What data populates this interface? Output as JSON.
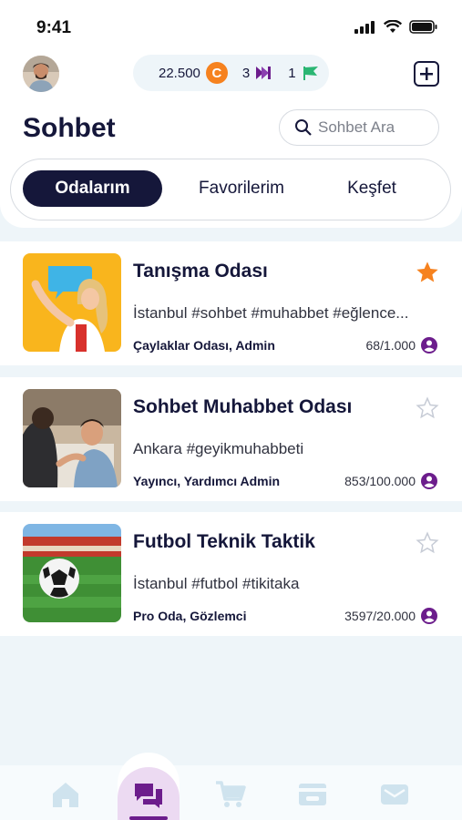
{
  "status_bar": {
    "time": "9:41"
  },
  "header": {
    "coins": "22.500",
    "coin_symbol": "C",
    "tickets": "3",
    "flags": "1"
  },
  "page": {
    "title": "Sohbet",
    "search_placeholder": "Sohbet Ara"
  },
  "tabs": [
    {
      "label": "Odalarım",
      "active": true
    },
    {
      "label": "Favorilerim",
      "active": false
    },
    {
      "label": "Keşfet",
      "active": false
    }
  ],
  "rooms": [
    {
      "title": "Tanışma Odası",
      "description": "İstanbul #sohbet #muhabbet #eğlence...",
      "role": "Çaylaklar Odası, Admin",
      "members": "68/1.000",
      "favorite": true
    },
    {
      "title": "Sohbet Muhabbet Odası",
      "description": "Ankara #geyikmuhabbeti",
      "role": "Yayıncı, Yardımcı Admin",
      "members": "853/100.000",
      "favorite": false
    },
    {
      "title": "Futbol Teknik Taktik",
      "description": "İstanbul #futbol #tikitaka",
      "role": "Pro Oda, Gözlemci",
      "members": "3597/20.000",
      "favorite": false
    }
  ],
  "nav": [
    {
      "icon": "home-icon",
      "active": false
    },
    {
      "icon": "chat-icon",
      "active": true
    },
    {
      "icon": "cart-icon",
      "active": false
    },
    {
      "icon": "wallet-icon",
      "active": false
    },
    {
      "icon": "mail-icon",
      "active": false
    }
  ],
  "colors": {
    "primary": "#15173a",
    "accent": "#6c1d8c",
    "coin": "#f6821f",
    "favorite_star": "#f6821f",
    "background": "#eef5f9"
  }
}
